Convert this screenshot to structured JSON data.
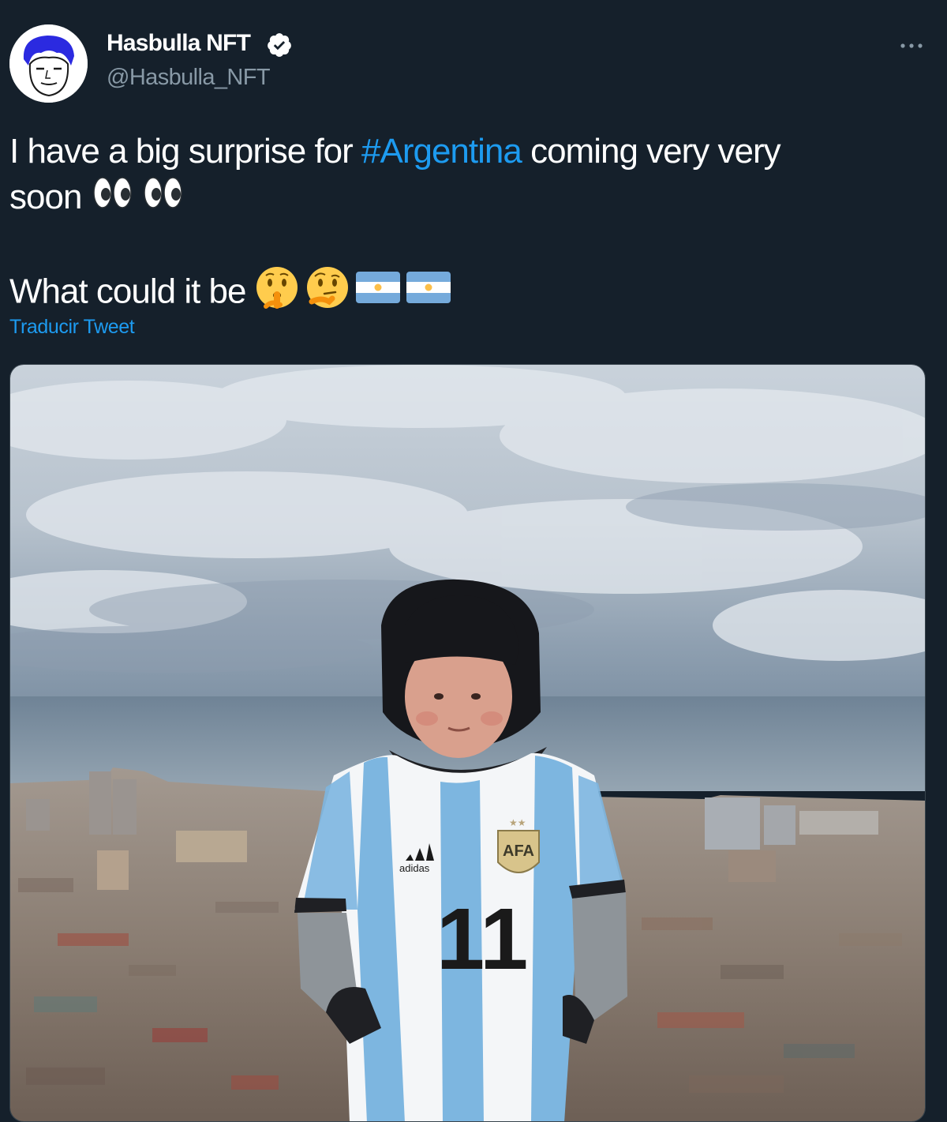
{
  "tweet": {
    "author": {
      "display_name": "Hasbulla NFT",
      "handle": "@Hasbulla_NFT",
      "verified": true,
      "avatar_icon": "cartoon-face-avatar"
    },
    "text": {
      "line1_before": "I have a big surprise for ",
      "hashtag": "#Argentina",
      "line1_after": " coming very very",
      "line2": "soon",
      "line3": "What could it be"
    },
    "emojis": {
      "line2": [
        "eyes-emoji",
        "eyes-emoji"
      ],
      "line3": [
        "shushing-face-emoji",
        "thinking-face-emoji",
        "argentina-flag-emoji",
        "argentina-flag-emoji"
      ]
    },
    "translate_link": "Traducir Tweet",
    "more_icon": "more-horizontal-icon",
    "media": {
      "jersey_number": "11",
      "brand_text": "adidas",
      "badge_text": "AFA"
    }
  },
  "colors": {
    "background": "#15202b",
    "link": "#1d9bf0",
    "secondary_text": "#8899a6",
    "text": "#ffffff"
  }
}
